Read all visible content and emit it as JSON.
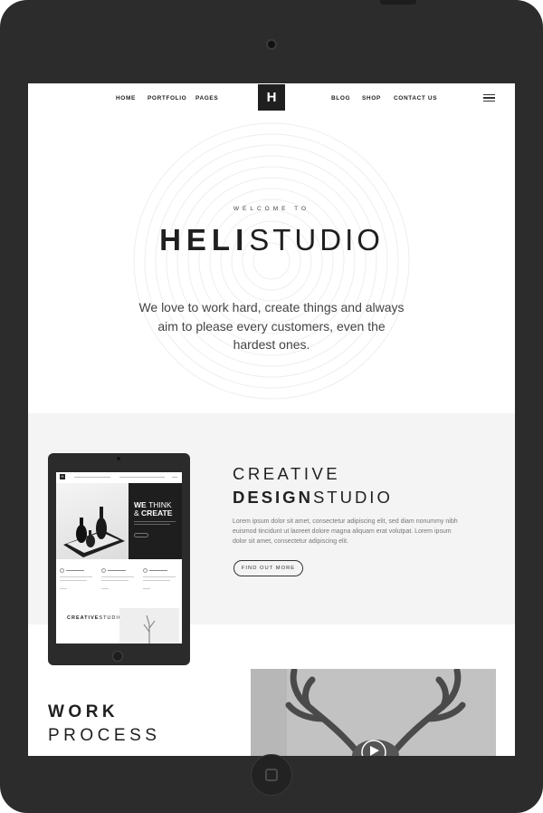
{
  "nav": {
    "left_items": [
      "HOME",
      "PORTFOLIO",
      "PAGES"
    ],
    "logo": "H",
    "right_items": [
      "BLOG",
      "SHOP",
      "CONTACT US"
    ]
  },
  "hero": {
    "welcome": "WELCOME TO",
    "title_bold": "HELI",
    "title_light": "STUDIO",
    "subtitle": "We love to work hard, create things and always aim to please every customers, even the hardest ones."
  },
  "tablet_preview": {
    "logo": "H",
    "headline_we": "WE",
    "headline_think": "THINK",
    "headline_amp": "&",
    "headline_create": "CREATE",
    "bottom_bold": "CREATIVE",
    "bottom_light": "STUDIO"
  },
  "creative": {
    "line1": "CREATIVE",
    "line2_bold": "DESIGN",
    "line2_light": "STUDIO",
    "body": "Lorem ipsum dolor sit amet, consectetur adipiscing elit, sed diam nonummy nibh euismod tincidunt ut laoreet dolore magna aliquam erat volutpat. Lorem ipsum dolor sit amet, consectetur adipiscing elit.",
    "button": "FIND OUT MORE"
  },
  "work": {
    "line1": "WORK",
    "line2": "PROCESS"
  },
  "colors": {
    "device": "#2c2c2c",
    "band": "#f4f4f4",
    "dark": "#1f1f1f"
  }
}
